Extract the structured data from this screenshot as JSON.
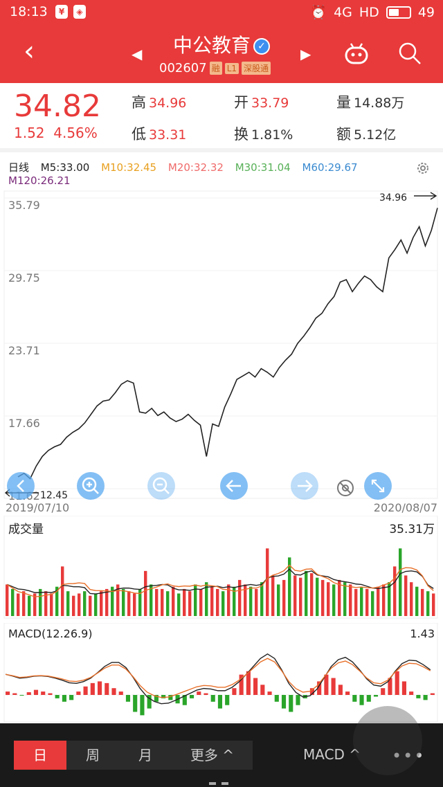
{
  "status": {
    "time": "18:13",
    "signal": "4G",
    "hd": "HD",
    "battery": "49"
  },
  "header": {
    "title": "中公教育",
    "code": "002607",
    "tags": [
      "融",
      "L1",
      "深股通"
    ]
  },
  "quote": {
    "price": "34.82",
    "change": "1.52",
    "change_pct": "4.56%",
    "high_label": "高",
    "high": "34.96",
    "low_label": "低",
    "low": "33.31",
    "open_label": "开",
    "open": "33.79",
    "turnover_label": "换",
    "turnover": "1.81%",
    "volume_label": "量",
    "volume": "14.88万",
    "amount_label": "额",
    "amount": "5.12亿"
  },
  "ma": {
    "period": "日线",
    "m5": "M5:33.00",
    "m10": "M10:32.45",
    "m20": "M20:32.32",
    "m30": "M30:31.04",
    "m60": "M60:29.67",
    "m120": "M120:26.21"
  },
  "colors": {
    "up": "#e83a3a",
    "down": "#2aa52a",
    "m5": "#222222",
    "m10": "#e8a020",
    "m20": "#f06a6a",
    "m30": "#58b058",
    "m60": "#3a8ad0",
    "m120": "#7a2a7a"
  },
  "price_chart": {
    "y_ticks": [
      "35.79",
      "29.75",
      "23.71",
      "17.66",
      "11.62"
    ],
    "high_marker": "34.96",
    "low_marker": "12.45",
    "start_date": "2019/07/10",
    "end_date": "2020/08/07"
  },
  "chart_data": [
    {
      "type": "line",
      "ylim": [
        11.62,
        35.79
      ],
      "x": [
        "2019/07/10",
        "2020/08/07"
      ],
      "series": [
        {
          "values": [
            12.6,
            12.9,
            12.45,
            13.5,
            14.3,
            14.8,
            15.1,
            15.3,
            15.9,
            16.3,
            16.6,
            17.1,
            17.8,
            18.5,
            18.9,
            19.0,
            19.6,
            20.3,
            20.6,
            20.4,
            18.0,
            17.9,
            18.3,
            17.7,
            18.0,
            17.5,
            17.2,
            17.4,
            17.8,
            17.3,
            16.9,
            14.3,
            17.0,
            16.8,
            18.4,
            19.5,
            20.7,
            21.0,
            21.3,
            20.9,
            21.6,
            21.3,
            20.9,
            21.7,
            22.3,
            22.8,
            23.7,
            24.3,
            25.0,
            25.8,
            26.2,
            27.0,
            27.6,
            28.8,
            29.0,
            28.0,
            28.7,
            29.3,
            29.0,
            28.4,
            28.0,
            30.8,
            31.5,
            32.3,
            31.2,
            32.5,
            33.4,
            31.8,
            33.1,
            34.96
          ]
        }
      ]
    },
    {
      "type": "bar",
      "title": "成交量",
      "ylim": [
        0,
        35.31
      ],
      "series": [
        {
          "values": [
            14,
            12,
            10,
            11,
            9,
            10,
            12,
            11,
            10,
            13,
            22,
            11,
            9,
            10,
            11,
            9,
            10,
            11,
            12,
            13,
            14,
            12,
            11,
            10,
            12,
            20,
            14,
            12,
            12,
            11,
            13,
            10,
            12,
            11,
            14,
            12,
            15,
            13,
            12,
            11,
            14,
            13,
            16,
            14,
            13,
            12,
            15,
            30,
            18,
            14,
            16,
            26,
            18,
            17,
            20,
            19,
            17,
            16,
            15,
            14,
            16,
            15,
            14,
            12,
            13,
            12,
            11,
            13,
            14,
            15,
            22,
            30,
            18,
            15,
            13,
            12,
            11,
            10
          ]
        }
      ]
    },
    {
      "type": "bar",
      "title": "MACD(12.26.9)",
      "ylim": [
        -1.43,
        1.43
      ],
      "series": [
        {
          "values": [
            0.1,
            0.05,
            -0.02,
            0.08,
            0.15,
            0.1,
            0.05,
            -0.1,
            -0.2,
            -0.15,
            0.1,
            0.25,
            0.35,
            0.4,
            0.35,
            0.2,
            0.1,
            -0.2,
            -0.5,
            -0.6,
            -0.4,
            -0.2,
            -0.1,
            -0.15,
            -0.25,
            -0.3,
            -0.1,
            0.1,
            0.05,
            -0.2,
            -0.4,
            -0.3,
            0.2,
            0.6,
            0.7,
            0.5,
            0.3,
            0.1,
            -0.2,
            -0.4,
            -0.5,
            -0.3,
            -0.1,
            0.2,
            0.4,
            0.6,
            0.5,
            0.3,
            0.1,
            -0.2,
            -0.3,
            -0.2,
            -0.05,
            0.2,
            0.5,
            0.7,
            0.4,
            0.1,
            -0.1,
            -0.15,
            0.05
          ]
        }
      ]
    }
  ],
  "volume": {
    "label": "成交量",
    "max": "35.31万"
  },
  "macd": {
    "label": "MACD(12.26.9)",
    "max": "1.43"
  },
  "bottom": {
    "tabs": [
      "日",
      "周",
      "月",
      "更多 ^"
    ],
    "indicator": "MACD ^",
    "more": "•••"
  }
}
